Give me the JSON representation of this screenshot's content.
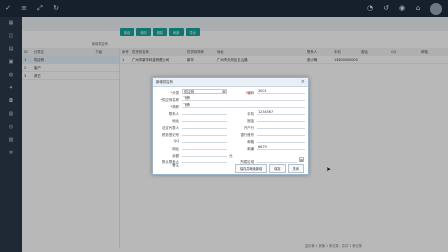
{
  "topbar": {
    "left_icons": [
      "check-icon",
      "menu-icon",
      "expand-icon",
      "refresh-icon"
    ],
    "right_icons": [
      "bell-icon",
      "history-icon",
      "lock-icon",
      "home-icon"
    ]
  },
  "sidebar": {
    "icons": [
      "dashboard-icon",
      "layers-icon",
      "doc-icon",
      "cart-icon",
      "user-icon",
      "wrench-icon",
      "lock-icon",
      "chart-icon",
      "people-icon",
      "building-icon",
      "gear-icon"
    ]
  },
  "toolbar": {
    "buttons": [
      "新增",
      "修改",
      "删除",
      "刷新",
      "导出"
    ]
  },
  "breadcrumb": "新增供应商",
  "tree": {
    "headers": [
      "ID",
      "分类名",
      "下级"
    ],
    "rows": [
      {
        "id": "1",
        "name": "供应商",
        "child": ""
      },
      {
        "id": "2",
        "name": "客户",
        "child": ""
      },
      {
        "id": "3",
        "name": "其它",
        "child": ""
      }
    ]
  },
  "grid": {
    "headers": [
      "序号",
      "供货商名称",
      "供货商简称",
      "地址",
      "联系人",
      "手机",
      "固话",
      "QQ",
      "邮箱"
    ],
    "rows": [
      [
        "1",
        "广州市新华科技有限公司",
        "新华",
        "广州市天河区五山路",
        "张小明",
        "13800000000",
        "",
        "",
        ""
      ]
    ]
  },
  "pager": "显示第 1 到第 1 条记录，总共 1 条记录",
  "dialog": {
    "title": "新增供应商",
    "close_glyph": "×",
    "fields": {
      "category_label": "分类",
      "category_value": "供应商",
      "code_label": "编码",
      "code_value": "3001",
      "name_label": "供应商名称",
      "name_value": "飞腾",
      "short_label": "简称",
      "short_value": "飞腾",
      "contact_label": "联系人",
      "mobile_label": "手机",
      "mobile_value": "1234567",
      "address_label": "地址",
      "phone_label": "固话",
      "fax_label": "开户行",
      "legal_label": "法定代表人",
      "manager_label": "税务登记号",
      "dept_label": "银行账号",
      "qq_label": "QQ",
      "email_label": "邮箱",
      "email_value": "",
      "website_label": "网址",
      "zip_label": "邮编",
      "zip_value": "6679",
      "balance_label": "余额",
      "balance_unit": "元",
      "credit_label": "默认联系人",
      "region_label": "所属区域",
      "remark_label": "备注"
    },
    "buttons": {
      "save_new": "保存并继续新增",
      "save": "保存",
      "close": "关闭"
    }
  }
}
